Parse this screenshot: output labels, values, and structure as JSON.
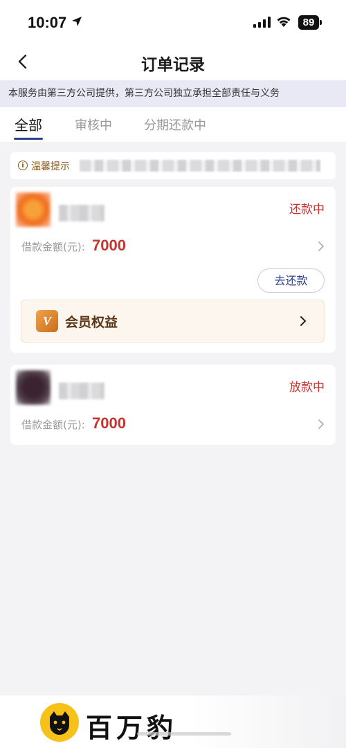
{
  "status_bar": {
    "time": "10:07",
    "battery": "89",
    "icons": [
      "location-arrow-icon",
      "signal-icon",
      "wifi-icon",
      "battery-icon"
    ]
  },
  "header": {
    "back_icon": "chevron-left-icon",
    "title": "订单记录"
  },
  "notice": "本服务由第三方公司提供，第三方公司独立承担全部责任与义务",
  "tabs": [
    {
      "label": "全部",
      "active": true
    },
    {
      "label": "审核中",
      "active": false
    },
    {
      "label": "分期还款中",
      "active": false
    }
  ],
  "tip": {
    "icon": "info-circle-icon",
    "label": "温馨提示"
  },
  "orders": [
    {
      "status": "还款中",
      "amount_label": "借款金额(元):",
      "amount": "7000",
      "action_label": "去还款",
      "vip": {
        "badge": "V",
        "label": "会员权益"
      }
    },
    {
      "status": "放款中",
      "amount_label": "借款金额(元):",
      "amount": "7000"
    }
  ],
  "brand": {
    "name": "百万豹",
    "icon": "leopard-logo-icon"
  },
  "colors": {
    "accent": "#2b3f8f",
    "status_red": "#c8322f",
    "notice_bg": "#e9e9f6",
    "vip_bg": "#fcf6ef",
    "page_bg": "#f3f3f5"
  }
}
